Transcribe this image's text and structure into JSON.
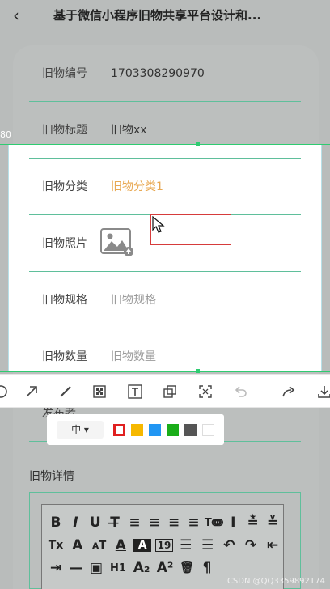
{
  "navbar": {
    "back_icon": "chevron-left-icon",
    "title": "基于微信小程序旧物共享平台设计和..."
  },
  "form": {
    "fields": [
      {
        "label": "旧物编号",
        "value": "1703308290970"
      },
      {
        "label": "旧物标题",
        "value": "旧物xx"
      },
      {
        "label": "旧物分类",
        "value": "旧物分类1"
      },
      {
        "label": "旧物照片",
        "value": ""
      },
      {
        "label": "旧物规格",
        "placeholder": "旧物规格"
      },
      {
        "label": "旧物数量",
        "placeholder": "旧物数量"
      },
      {
        "label": "发布者",
        "value": ""
      }
    ],
    "detail_label": "旧物详情"
  },
  "overlay": {
    "coord_text": "80"
  },
  "colors": {
    "accent_green": "#2ecc71",
    "category_orange": "#e8a852",
    "selection_red": "#d63b3b"
  },
  "screenshot_toolbar": {
    "tools": [
      "circle-icon",
      "arrow-icon",
      "pen-icon",
      "mosaic-icon",
      "text-icon",
      "ocr-icon",
      "capture-icon",
      "undo-icon",
      "share-icon",
      "download-icon"
    ],
    "size_label": "中 ▾",
    "colors": [
      "#e02020",
      "#f6b800",
      "#2196f3",
      "#1aad19",
      "#555555",
      "#ffffff"
    ]
  },
  "editor": {
    "row1": [
      "B",
      "I",
      "U",
      "T̶",
      "≡",
      "≡",
      "≡",
      "≡",
      "Tↈ",
      "I",
      "≛",
      "≚"
    ],
    "row2": [
      "Tx",
      "A",
      "ᴀT",
      "A",
      "A",
      "19",
      "☰",
      "☰",
      "↶",
      "↷",
      "⇤"
    ],
    "row3": [
      "⇥",
      "—",
      "▣",
      "H1",
      "A₂",
      "A²",
      "🗑",
      "¶"
    ]
  },
  "watermark": "CSDN @QQ3359892174"
}
